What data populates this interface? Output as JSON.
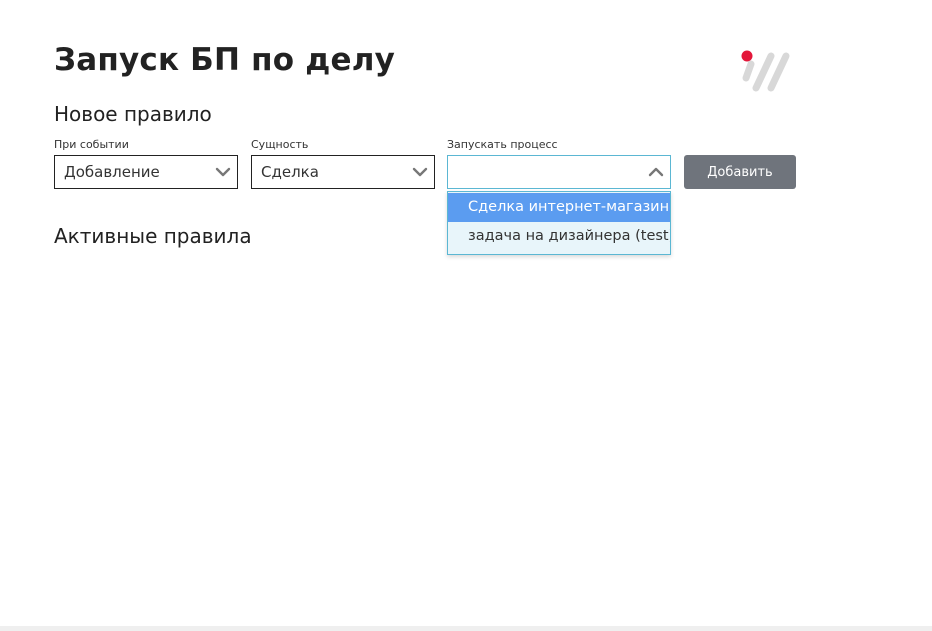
{
  "page": {
    "title": "Запуск БП по делу"
  },
  "new_rule": {
    "heading": "Новое правило",
    "event": {
      "label": "При событии",
      "value": "Добавление"
    },
    "entity": {
      "label": "Сущность",
      "value": "Сделка"
    },
    "process": {
      "label": "Запускать процесс",
      "value": "",
      "options": [
        "Сделка интернет-магазина",
        "задача на дизайнера (test)"
      ]
    },
    "add_button_label": "Добавить"
  },
  "active_rules": {
    "heading": "Активные правила"
  },
  "colors": {
    "logo_dot": "#e3173a",
    "logo_stripes": "#d8d8d8",
    "button_bg": "#6f747c",
    "dropdown_highlight": "#5b9cf0",
    "dropdown_bg": "#e8f5fa",
    "focus_border": "#5bb7d3"
  },
  "icons": {
    "logo": "brand-logo-icon",
    "select_chevron": "chevron-down-icon",
    "select_chevron_open": "chevron-up-icon"
  }
}
